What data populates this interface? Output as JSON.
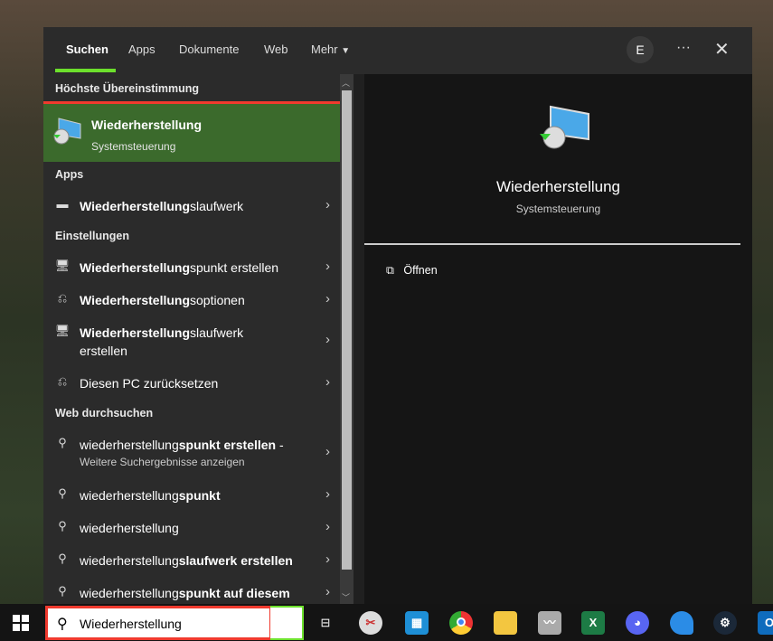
{
  "tabs": [
    "Suchen",
    "Apps",
    "Dokumente",
    "Web",
    "Mehr"
  ],
  "avatar": "E",
  "sections": {
    "best": "Höchste Übereinstimmung",
    "apps": "Apps",
    "settings": "Einstellungen",
    "web": "Web durchsuchen"
  },
  "best_match": {
    "title": "Wiederherstellung",
    "subtitle": "Systemsteuerung"
  },
  "apps": [
    {
      "bold": "Wiederherstellung",
      "rest": "slaufwerk",
      "icon": "drive-icon"
    }
  ],
  "settings": [
    {
      "bold": "Wiederherstellung",
      "rest": "spunkt erstellen",
      "icon": "monitor-icon"
    },
    {
      "bold": "Wiederherstellung",
      "rest": "soptionen",
      "icon": "reset-icon"
    },
    {
      "bold": "Wiederherstellung",
      "rest": "slaufwerk erstellen",
      "icon": "monitor-icon"
    },
    {
      "bold": "",
      "rest": "Diesen PC zurücksetzen",
      "icon": "reset-icon"
    }
  ],
  "web": [
    {
      "plain": "wiederherstellung",
      "bold": "spunkt erstellen",
      "tail": " -",
      "sub": "Weitere Suchergebnisse anzeigen"
    },
    {
      "plain": "wiederherstellung",
      "bold": "spunkt"
    },
    {
      "plain": "wiederherstellung",
      "bold": ""
    },
    {
      "plain": "wiederherstellung",
      "bold": "slaufwerk erstellen"
    },
    {
      "plain": "wiederherstellung",
      "bold": "spunkt auf diesem"
    }
  ],
  "preview": {
    "title": "Wiederherstellung",
    "subtitle": "Systemsteuerung",
    "action": "Öffnen"
  },
  "taskbar": {
    "search_value": "Wiederherstellung",
    "apps": [
      "task-view",
      "snipping-tool",
      "store-app",
      "chrome",
      "file-explorer",
      "performance-monitor",
      "excel",
      "discord",
      "blue-app",
      "steam",
      "outlook"
    ]
  },
  "colors": {
    "accent": "#6ce02c",
    "highlight": "#3b6a2c",
    "annotation": "#f03a2e"
  }
}
